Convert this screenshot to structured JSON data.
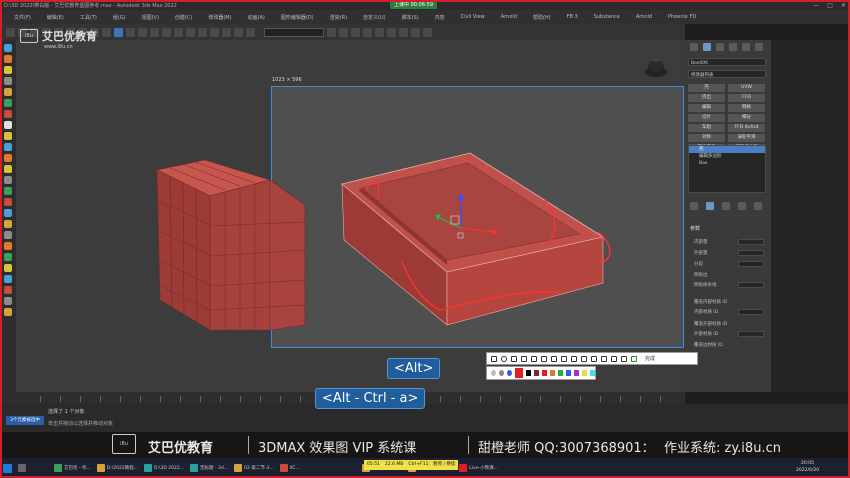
{
  "window": {
    "title": "D:\\3D 2022\\带白版 - 艾巴优教育蓝图参考.max - Autodesk 3ds Max 2022",
    "controls": [
      "—",
      "□",
      "✕"
    ]
  },
  "recording_badge": "上课中 00:06:59",
  "menu": [
    "文件(F)",
    "编辑(E)",
    "工具(T)",
    "组(G)",
    "视图(V)",
    "创建(C)",
    "修改器(M)",
    "动画(A)",
    "图形编辑器(D)",
    "渲染(R)",
    "自定义(U)",
    "脚本(S)",
    "内容",
    "Civil View",
    "Arnold",
    "帮助(H)",
    "FB 3",
    "Substance",
    "Arnold",
    "Phoenix FD"
  ],
  "toolbar": {
    "selection_set_placeholder": "创建选择集"
  },
  "viewport": {
    "logo_text": "艾巴优教育",
    "logo_mark": "i8u",
    "logo_url": "www.i8u.cn",
    "capture_size": "1023 × 596"
  },
  "command_panel": {
    "object_name": "Box006",
    "modifier_list": "修改器列表",
    "buttons": [
      "壳",
      "UVW",
      "挤出",
      "FFD",
      "编辑",
      "网格",
      "切片",
      "细分",
      "车削",
      "FFD 4x4x4",
      "对称",
      "涡轮平滑",
      "网格平滑",
      "编辑多边形"
    ],
    "stack": [
      {
        "label": "壳",
        "selected": true
      },
      {
        "label": "编辑多边形",
        "selected": false
      },
      {
        "label": "Box",
        "selected": false
      }
    ],
    "params_title": "参数",
    "params": [
      {
        "label": "内部量"
      },
      {
        "label": "外部量"
      },
      {
        "label": "分段"
      },
      {
        "label": "倒角边"
      },
      {
        "label": "倒角样条线"
      },
      {
        "label": "覆盖内部材质 ID"
      },
      {
        "label": "内部材质 ID"
      },
      {
        "label": "覆盖外部材质 ID"
      },
      {
        "label": "外部材质 ID"
      },
      {
        "label": "覆盖边材质 ID"
      }
    ]
  },
  "key_hints": {
    "alt": "<Alt>",
    "alt_ctrl": "<Alt - Ctrl - a>"
  },
  "snip_toolbar": {
    "done_label": "完成"
  },
  "status": {
    "badge": "3个元素被选中",
    "line1": "选择了 1 个对象",
    "line2": "单击并拖动以选择并移动对象"
  },
  "banner": {
    "logo_mark": "i8u",
    "name": "艾巴优教育",
    "course": "3DMAX 效果图 VIP 系统课",
    "qq": "甜橙老师 QQ:3007368901：",
    "site": "作业系统: zy.i8u.cn"
  },
  "taskbar": {
    "apps": [
      "艾巴优 - 作...",
      "D:\\2022教程...",
      "D:\\3D 2022...",
      "无标题 - 3d...",
      "02-第二节-3...",
      "XC...",
      "04-第二节-3...",
      "02-第二节-知识...",
      "Live-小熊课..."
    ],
    "recorder": [
      "05:51",
      "22.6 MB",
      "Ctrl+F11：暂停 / 继续"
    ],
    "clock_time": "20:05",
    "clock_date": "2022/6/20"
  },
  "colors": {
    "accent": "#3a76b8",
    "frame": "#d0202a",
    "object": "#b5413d",
    "selection": "#4a7fc3"
  }
}
